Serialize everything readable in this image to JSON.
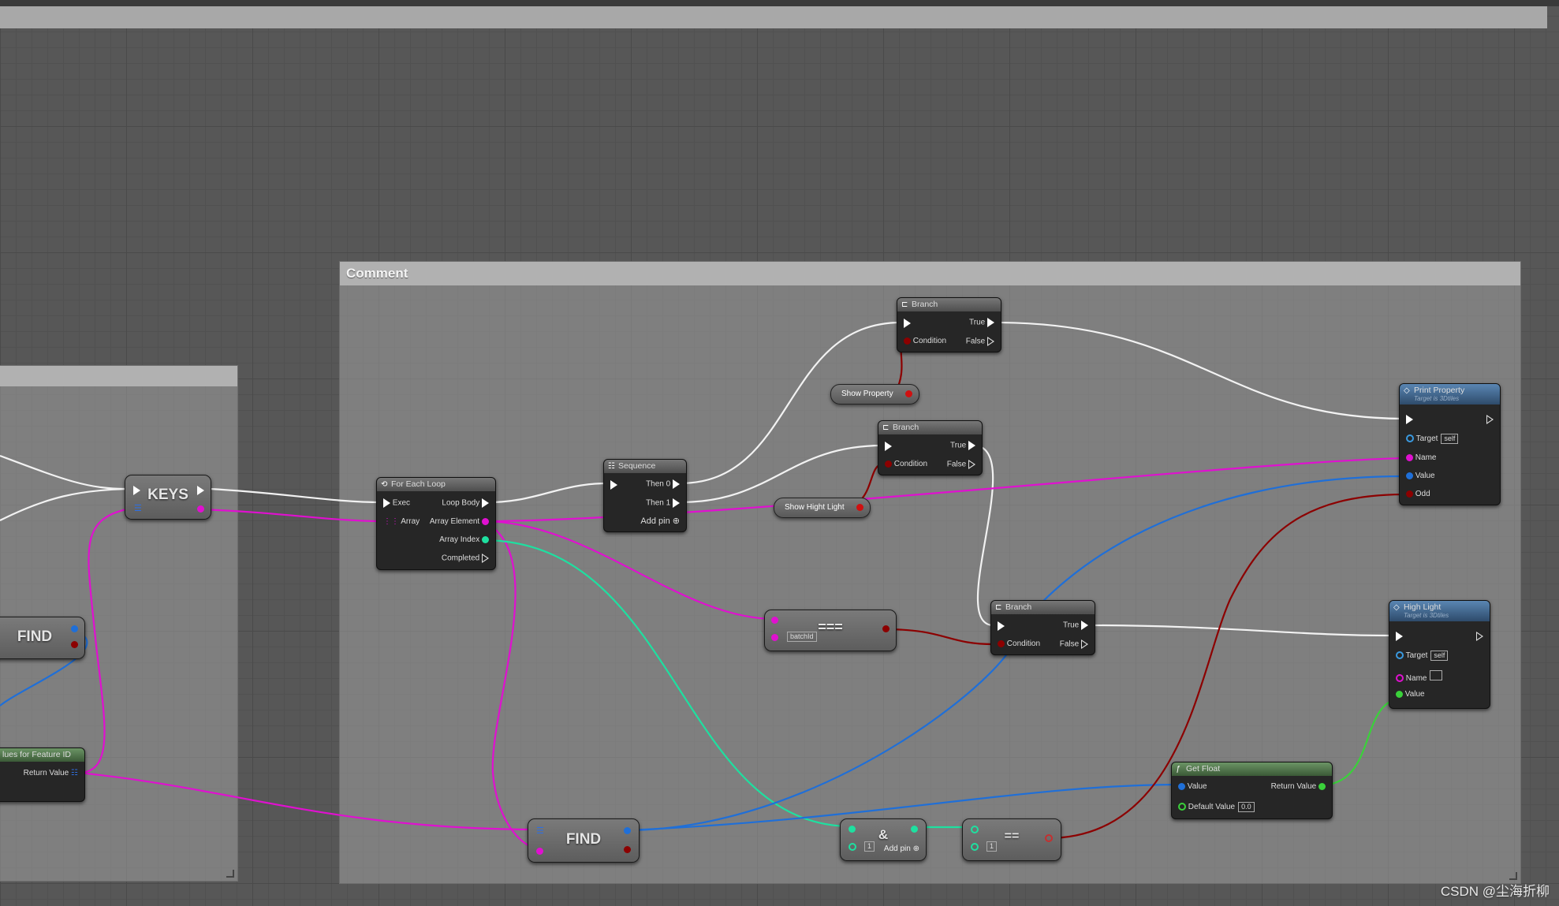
{
  "comment_main": {
    "title": "Comment"
  },
  "nodes": {
    "keys": {
      "title": "KEYS"
    },
    "find_left": {
      "title": "FIND"
    },
    "feature": {
      "title": "lues for Feature ID",
      "return_value": "Return Value"
    },
    "for_each": {
      "title": "For Each Loop",
      "exec": "Exec",
      "array": "Array",
      "loop_body": "Loop Body",
      "array_element": "Array Element",
      "array_index": "Array Index",
      "completed": "Completed"
    },
    "sequence": {
      "title": "Sequence",
      "then0": "Then 0",
      "then1": "Then 1",
      "add_pin": "Add pin"
    },
    "branch1": {
      "title": "Branch",
      "condition": "Condition",
      "true": "True",
      "false": "False"
    },
    "branch2": {
      "title": "Branch",
      "condition": "Condition",
      "true": "True",
      "false": "False"
    },
    "branch3": {
      "title": "Branch",
      "condition": "Condition",
      "true": "True",
      "false": "False"
    },
    "show_property": {
      "label": "Show Property"
    },
    "show_highlight": {
      "label": "Show Hight Light"
    },
    "equals_str": {
      "symbol": "===",
      "input": "batchId"
    },
    "print_property": {
      "title": "Print Property",
      "subtitle": "Target is 3Dtiles",
      "target": "Target",
      "target_val": "self",
      "name": "Name",
      "value": "Value",
      "odd": "Odd"
    },
    "high_light": {
      "title": "High Light",
      "subtitle": "Target is 3Dtiles",
      "target": "Target",
      "target_val": "self",
      "name": "Name",
      "value": "Value"
    },
    "get_float": {
      "title": "Get Float",
      "value": "Value",
      "return_value": "Return Value",
      "default_value": "Default Value",
      "default_val": "0.0"
    },
    "find_bottom": {
      "title": "FIND"
    },
    "and_node": {
      "symbol": "&",
      "val": "1",
      "add_pin": "Add pin"
    },
    "equals_int": {
      "symbol": "==",
      "val": "1"
    }
  },
  "watermark": "CSDN @尘海折柳",
  "colors": {
    "exec": "#ffffff",
    "bool": "#8c0000",
    "string": "#e010d0",
    "int": "#1ee0a0",
    "float": "#3ad13a",
    "struct": "#1f6fd8"
  }
}
